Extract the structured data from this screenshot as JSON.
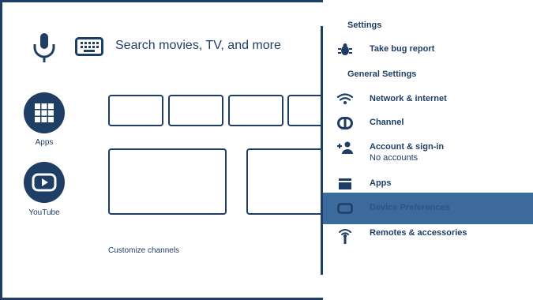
{
  "home": {
    "search_placeholder": "Search movies, TV, and more",
    "apps_label": "Apps",
    "youtube_label": "YouTube",
    "customize_label": "Customize channels",
    "icons": [
      "mic-icon",
      "keyboard-icon",
      "apps-grid-icon",
      "youtube-play-icon"
    ]
  },
  "settings": {
    "title": "Settings",
    "bug_report": "Take bug report",
    "section_general": "General Settings",
    "items": [
      {
        "label": "Network & internet",
        "icon": "wifi-icon"
      },
      {
        "label": "Channel",
        "icon": "channel-icon"
      },
      {
        "label": "Account & sign-in",
        "sublabel": "No accounts",
        "icon": "account-add-icon"
      },
      {
        "label": "Apps",
        "icon": "apps-icon"
      },
      {
        "label": "Device Preferences",
        "icon": "device-icon",
        "selected": true
      },
      {
        "label": "Remotes & accessories",
        "icon": "remote-icon"
      }
    ]
  },
  "colors": {
    "primary": "#1f3e66",
    "selected_bg": "#3d6a9c",
    "background": "#ffffff"
  }
}
